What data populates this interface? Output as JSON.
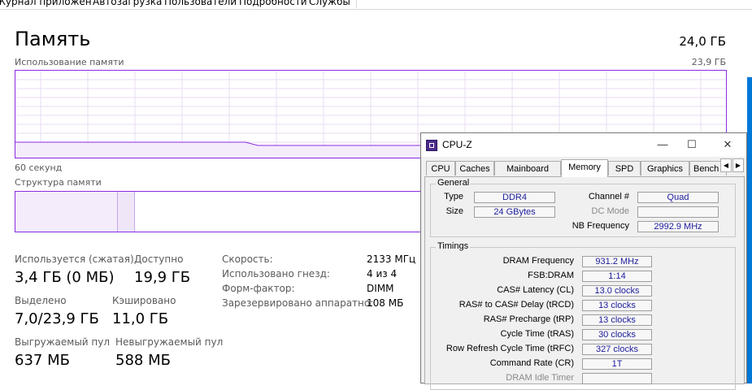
{
  "taskmanager": {
    "tabs": [
      "Журнал приложений",
      "Автозагрузка",
      "Пользователи",
      "Подробности",
      "Службы"
    ],
    "title": "Память",
    "total": "24,0 ГБ",
    "usage_label": "Использование памяти",
    "usage_max": "23,9 ГБ",
    "time_label": "60 секунд",
    "structure_label": "Структура памяти",
    "stats": {
      "in_use_label": "Используется (сжатая)",
      "in_use_value": "3,4 ГБ (0 МБ)",
      "available_label": "Доступно",
      "available_value": "19,9 ГБ",
      "committed_label": "Выделено",
      "committed_value": "7,0/23,9 ГБ",
      "cached_label": "Кэшировано",
      "cached_value": "11,0 ГБ",
      "paged_label": "Выгружаемый пул",
      "paged_value": "637 МБ",
      "nonpaged_label": "Невыгружаемый пул",
      "nonpaged_value": "588 МБ"
    },
    "details": [
      {
        "label": "Скорость:",
        "value": "2133 МГц"
      },
      {
        "label": "Использовано гнезд:",
        "value": "4 из 4"
      },
      {
        "label": "Форм-фактор:",
        "value": "DIMM"
      },
      {
        "label": "Зарезервировано аппаратно:",
        "value": "108 МБ"
      }
    ],
    "accent_color": "#8a2be2"
  },
  "cpuz": {
    "title": "CPU-Z",
    "tabs": [
      "CPU",
      "Caches",
      "Mainboard",
      "Memory",
      "SPD",
      "Graphics",
      "Bench"
    ],
    "active_tab": "Memory",
    "general": {
      "title": "General",
      "type_label": "Type",
      "type_value": "DDR4",
      "size_label": "Size",
      "size_value": "24 GBytes",
      "channel_label": "Channel #",
      "channel_value": "Quad",
      "dc_label": "DC Mode",
      "dc_value": "",
      "nb_label": "NB Frequency",
      "nb_value": "2992.9 MHz"
    },
    "timings": {
      "title": "Timings",
      "rows": [
        {
          "label": "DRAM Frequency",
          "value": "931.2 MHz"
        },
        {
          "label": "FSB:DRAM",
          "value": "1:14"
        },
        {
          "label": "CAS# Latency (CL)",
          "value": "13.0 clocks"
        },
        {
          "label": "RAS# to CAS# Delay (tRCD)",
          "value": "13 clocks"
        },
        {
          "label": "RAS# Precharge (tRP)",
          "value": "13 clocks"
        },
        {
          "label": "Cycle Time (tRAS)",
          "value": "30 clocks"
        },
        {
          "label": "Row Refresh Cycle Time (tRFC)",
          "value": "327 clocks"
        },
        {
          "label": "Command Rate (CR)",
          "value": "1T"
        },
        {
          "label": "DRAM Idle Timer",
          "value": ""
        }
      ]
    }
  }
}
